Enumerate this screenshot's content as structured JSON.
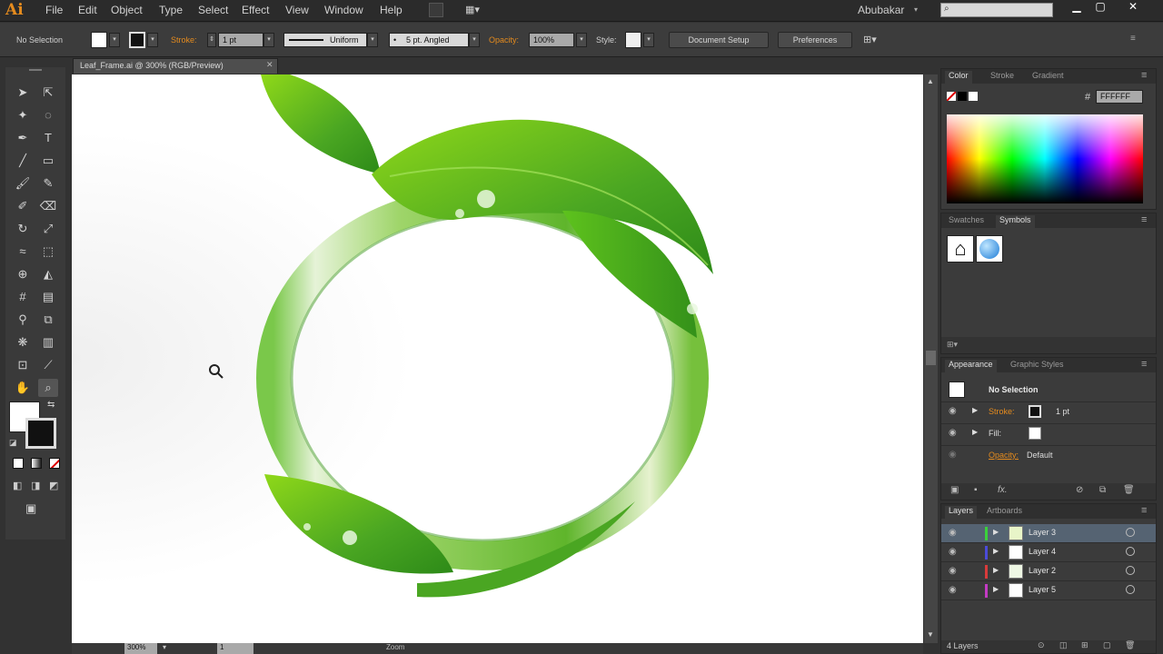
{
  "app": {
    "logo": "Ai",
    "user": "Abubakar"
  },
  "menu": [
    "File",
    "Edit",
    "Object",
    "Type",
    "Select",
    "Effect",
    "View",
    "Window",
    "Help"
  ],
  "control": {
    "selection": "No Selection",
    "stroke_label": "Stroke:",
    "stroke_weight": "1 pt",
    "profile": "Uniform",
    "brush": "5 pt. Angled",
    "opacity_label": "Opacity:",
    "opacity_value": "100%",
    "style_label": "Style:",
    "document_setup": "Document Setup",
    "preferences": "Preferences"
  },
  "document": {
    "tab_title": "Leaf_Frame.ai @ 300% (RGB/Preview)"
  },
  "status": {
    "zoom": "300%",
    "page": "1",
    "tool": "Zoom"
  },
  "color_panel": {
    "tabs": [
      "Color",
      "Stroke",
      "Gradient"
    ],
    "hex_label": "#",
    "hex_value": "FFFFFF"
  },
  "symbols_panel": {
    "tabs": [
      "Swatches",
      "Symbols"
    ]
  },
  "appearance_panel": {
    "tabs": [
      "Appearance",
      "Graphic Styles"
    ],
    "selection": "No Selection",
    "stroke_label": "Stroke:",
    "stroke_value": "1 pt",
    "fill_label": "Fill:",
    "opacity_label": "Opacity:",
    "opacity_value": "Default"
  },
  "layers_panel": {
    "tabs": [
      "Layers",
      "Artboards"
    ],
    "layers": [
      {
        "name": "Layer 3",
        "color": "#3bd13b",
        "selected": true
      },
      {
        "name": "Layer 4",
        "color": "#4b4bd8",
        "selected": false
      },
      {
        "name": "Layer 2",
        "color": "#d83b3b",
        "selected": false
      },
      {
        "name": "Layer 5",
        "color": "#c33bc3",
        "selected": false
      }
    ],
    "count": "4 Layers"
  },
  "colors": {
    "accent_orange": "#e48b1e",
    "leaf_green": "#5cb82a",
    "panel_bg": "#3b3b3b"
  }
}
